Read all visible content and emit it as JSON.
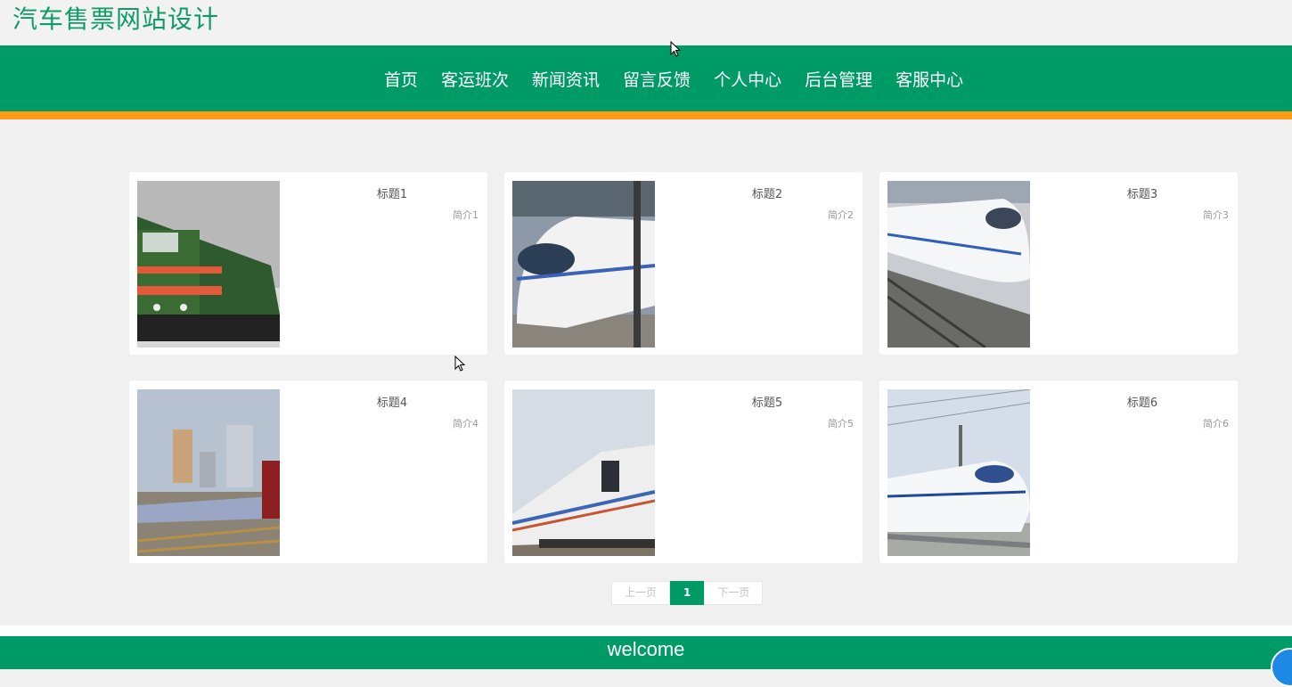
{
  "site": {
    "title": "汽车售票网站设计"
  },
  "nav": {
    "items": [
      "首页",
      "客运班次",
      "新闻资讯",
      "留言反馈",
      "个人中心",
      "后台管理",
      "客服中心"
    ]
  },
  "cards": [
    {
      "title": "标题1",
      "desc": "简介1",
      "image": "green-diesel-locomotive"
    },
    {
      "title": "标题2",
      "desc": "简介2",
      "image": "white-high-speed-train"
    },
    {
      "title": "标题3",
      "desc": "简介3",
      "image": "white-high-speed-train-on-tracks"
    },
    {
      "title": "标题4",
      "desc": "简介4",
      "image": "passenger-train-city-skyline"
    },
    {
      "title": "标题5",
      "desc": "简介5",
      "image": "white-locomotive-blue-stripe"
    },
    {
      "title": "标题6",
      "desc": "简介6",
      "image": "crh-bullet-train"
    }
  ],
  "pagination": {
    "prev": "上一页",
    "current": "1",
    "next": "下一页"
  },
  "footer": {
    "text": "welcome"
  },
  "colors": {
    "brand_green": "#009a67",
    "accent_orange": "#ff9a16",
    "title_green": "#0f9c67"
  }
}
